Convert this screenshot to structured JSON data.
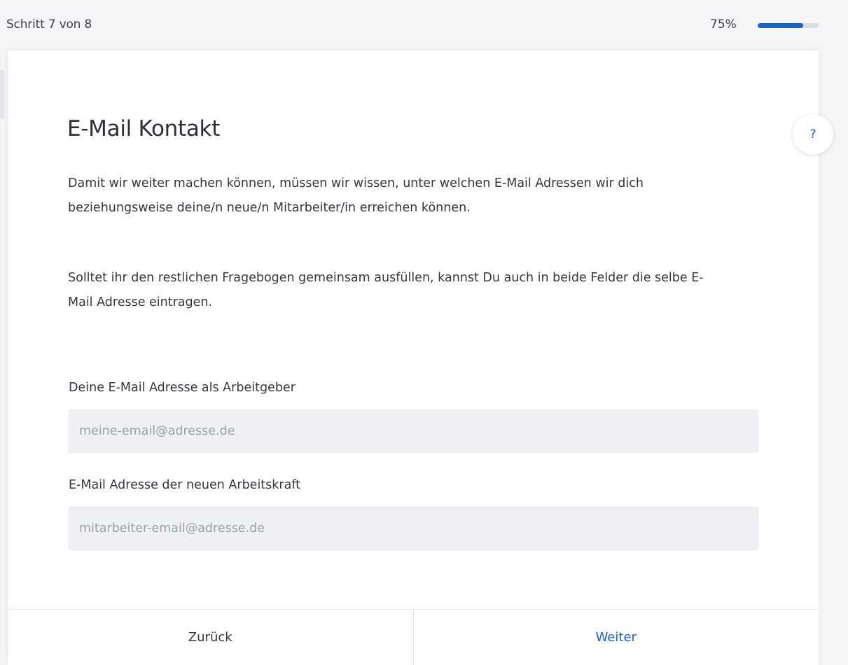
{
  "header": {
    "step_text": "Schritt 7 von 8",
    "progress_text": "75%",
    "progress_value": 0.75,
    "progress_color": "#1f5fc9"
  },
  "help": {
    "label": "?",
    "icon": "question-icon"
  },
  "main": {
    "title": "E-Mail Kontakt",
    "paragraph1": "Damit wir weiter machen können, müssen wir wissen, unter welchen E-Mail Adressen wir dich beziehungsweise deine/n neue/n Mitarbeiter/in erreichen können.",
    "paragraph2": "Solltet ihr den restlichen Fragebogen gemeinsam ausfüllen, kannst Du auch in beide Felder die selbe E-Mail Adresse eintragen.",
    "employer_email": {
      "label": "Deine E-Mail Adresse als Arbeitgeber",
      "placeholder": "meine-email@adresse.de",
      "value": ""
    },
    "employee_email": {
      "label": "E-Mail Adresse der neuen Arbeitskraft",
      "placeholder": "mitarbeiter-email@adresse.de",
      "value": ""
    }
  },
  "footer": {
    "back_label": "Zurück",
    "next_label": "Weiter"
  }
}
